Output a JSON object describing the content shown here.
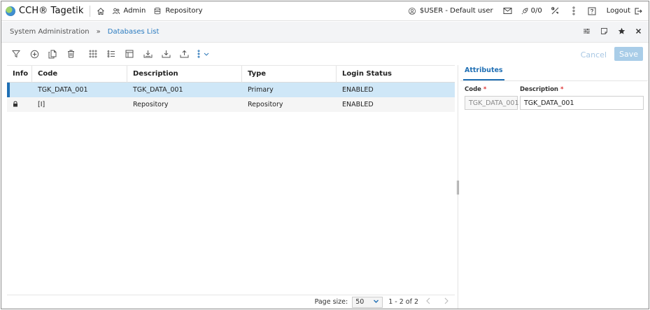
{
  "app": {
    "brand": "CCH® Tagetik",
    "nav_admin": "Admin",
    "nav_repository": "Repository",
    "user": "$USER - Default user",
    "jobs_count": "0/0",
    "logout": "Logout"
  },
  "breadcrumb": {
    "section": "System Administration",
    "separator": "»",
    "current": "Databases List"
  },
  "toolbar": {
    "cancel": "Cancel",
    "save": "Save"
  },
  "table": {
    "headers": {
      "info": "Info",
      "code": "Code",
      "description": "Description",
      "type": "Type",
      "login_status": "Login Status"
    },
    "rows": [
      {
        "info": "",
        "code": "TGK_DATA_001",
        "description": "TGK_DATA_001",
        "type": "Primary",
        "login_status": "ENABLED"
      },
      {
        "info": "lock-icon",
        "code": "[I]",
        "description": "Repository",
        "type": "Repository",
        "login_status": "ENABLED"
      }
    ],
    "selected_row": 0
  },
  "pager": {
    "label": "Page size:",
    "size": "50",
    "range": "1 - 2 of 2"
  },
  "attributes": {
    "tab": "Attributes",
    "code_label": "Code",
    "description_label": "Description",
    "required_mark": "*",
    "code_value": "TGK_DATA_001",
    "description_value": "TGK_DATA_001"
  },
  "colors": {
    "accent": "#1f6fb4",
    "selected_row": "#cfe7f7",
    "save_disabled": "#a9cde8"
  }
}
